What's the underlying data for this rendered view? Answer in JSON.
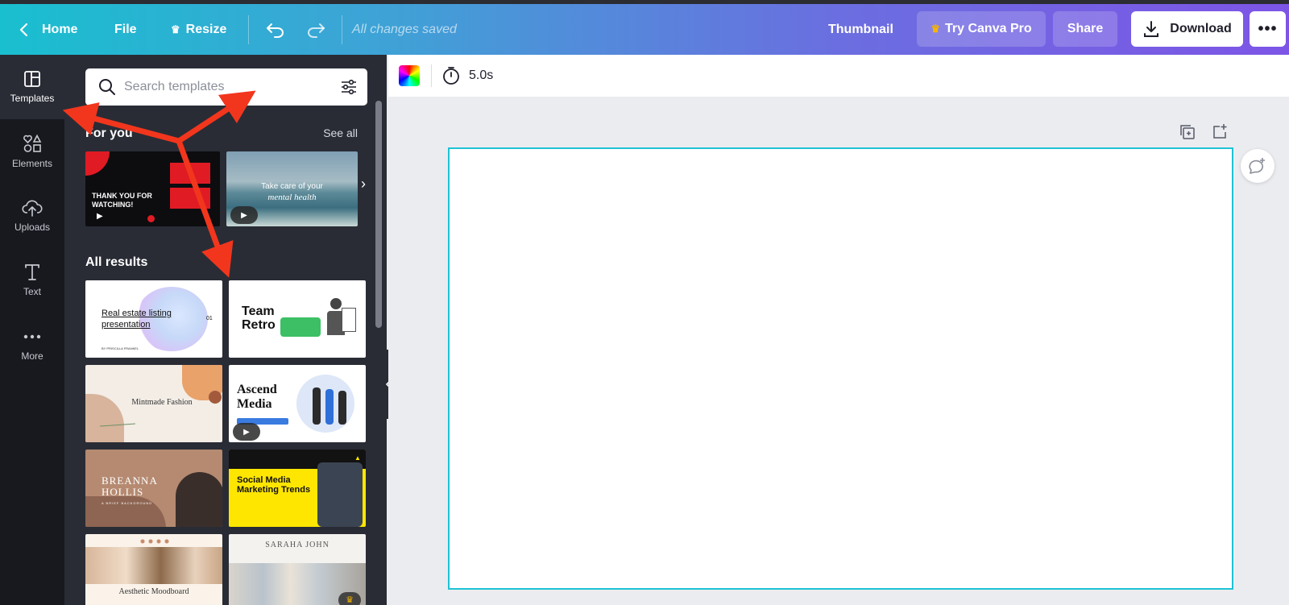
{
  "topbar": {
    "home_label": "Home",
    "file_label": "File",
    "resize_label": "Resize",
    "saved_status": "All changes saved",
    "thumbnail_label": "Thumbnail",
    "pro_label": "Try Canva Pro",
    "share_label": "Share",
    "download_label": "Download"
  },
  "rail": {
    "items": [
      {
        "label": "Templates",
        "icon": "templates-icon",
        "active": true
      },
      {
        "label": "Elements",
        "icon": "elements-icon"
      },
      {
        "label": "Uploads",
        "icon": "uploads-icon"
      },
      {
        "label": "Text",
        "icon": "text-icon"
      },
      {
        "label": "More",
        "icon": "more-dots-icon"
      }
    ]
  },
  "panel": {
    "search_placeholder": "Search templates",
    "for_you_title": "For you",
    "see_all_label": "See all",
    "all_results_title": "All results",
    "for_you_cards": [
      {
        "text": "THANK YOU FOR WATCHING!"
      },
      {
        "text1": "Take care of your",
        "text2": "mental health"
      }
    ],
    "results": [
      {
        "text": "Real estate listing presentation",
        "num": "01",
        "tiny": "BY PRISCILLA FRANKEL"
      },
      {
        "text": "Team Retro"
      },
      {
        "text": "Mintmade Fashion"
      },
      {
        "text": "Ascend Media"
      },
      {
        "text": "BREANNA HOLLIS",
        "tiny": "A BRIEF BACKGROUND"
      },
      {
        "text": "Social Media Marketing Trends"
      },
      {
        "text": "Aesthetic Moodboard"
      },
      {
        "text": "SARAHA JOHN"
      }
    ]
  },
  "canvas": {
    "duration": "5.0s"
  },
  "colors": {
    "accent_cyan": "#1ec3d4",
    "annotation_red": "#f2361d"
  }
}
